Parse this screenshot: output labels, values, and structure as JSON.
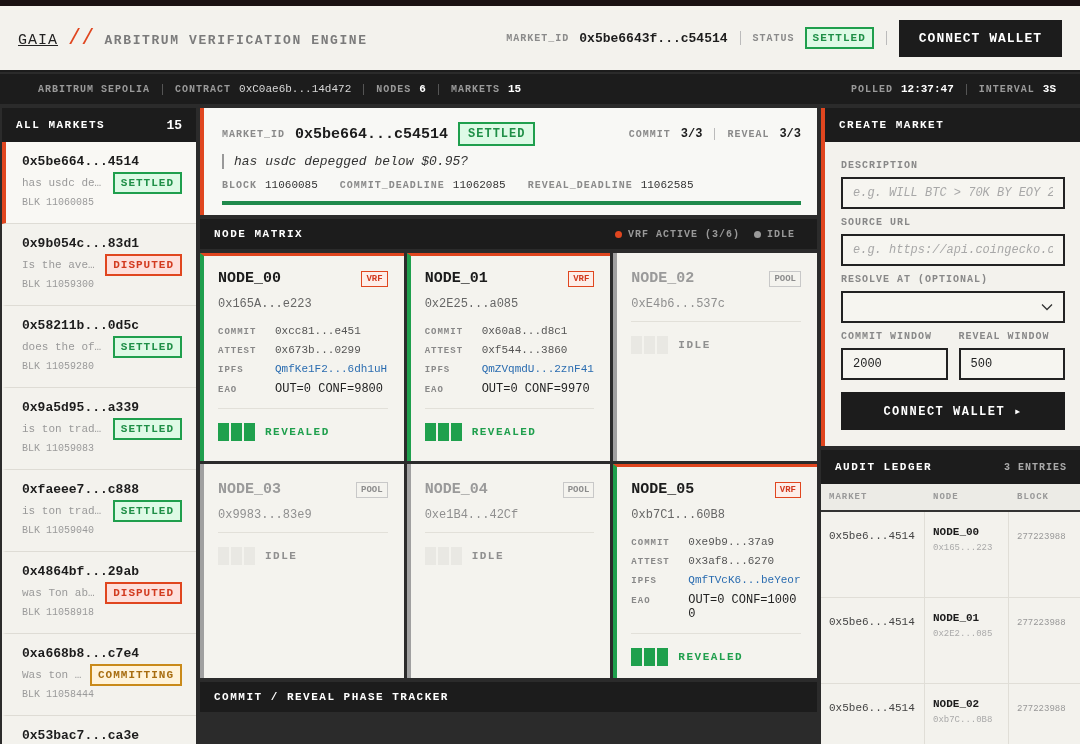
{
  "header": {
    "brand": "GAIA",
    "separator": "//",
    "subtitle": "ARBITRUM VERIFICATION ENGINE",
    "market_id_label": "MARKET_ID",
    "market_id": "0x5be6643f...c54514",
    "status_label": "STATUS",
    "status": {
      "label": "SETTLED",
      "kind": "settled"
    },
    "connect_button": "CONNECT WALLET"
  },
  "status_bar": {
    "left": [
      {
        "label": "ARBITRUM SEPOLIA"
      },
      {
        "label": "CONTRACT",
        "value": "0xC0ae6b...14d472",
        "strong": false
      },
      {
        "label": "NODES",
        "value": "6",
        "strong": true
      },
      {
        "label": "MARKETS",
        "value": "15",
        "strong": true
      }
    ],
    "right": [
      {
        "label": "POLLED",
        "value": "12:37:47",
        "strong": true
      },
      {
        "label": "INTERVAL",
        "value": "3S",
        "strong": true
      }
    ]
  },
  "markets": {
    "title": "ALL MARKETS",
    "count": "15",
    "items": [
      {
        "id": "0x5be664...4514",
        "desc": "has usdc de…",
        "status": {
          "label": "SETTLED",
          "kind": "settled"
        },
        "block": "BLK 11060085",
        "selected": true
      },
      {
        "id": "0x9b054c...83d1",
        "desc": "Is the ave…",
        "status": {
          "label": "DISPUTED",
          "kind": "disputed"
        },
        "block": "BLK 11059300",
        "selected": false
      },
      {
        "id": "0x58211b...0d5c",
        "desc": "does the of…",
        "status": {
          "label": "SETTLED",
          "kind": "settled"
        },
        "block": "BLK 11059280",
        "selected": false
      },
      {
        "id": "0x9a5d95...a339",
        "desc": "is ton trad…",
        "status": {
          "label": "SETTLED",
          "kind": "settled"
        },
        "block": "BLK 11059083",
        "selected": false
      },
      {
        "id": "0xfaeee7...c888",
        "desc": "is ton trad…",
        "status": {
          "label": "SETTLED",
          "kind": "settled"
        },
        "block": "BLK 11059040",
        "selected": false
      },
      {
        "id": "0x4864bf...29ab",
        "desc": "was Ton ab…",
        "status": {
          "label": "DISPUTED",
          "kind": "disputed"
        },
        "block": "BLK 11058918",
        "selected": false
      },
      {
        "id": "0xa668b8...c7e4",
        "desc": "Was ton …",
        "status": {
          "label": "COMMITTING",
          "kind": "committing"
        },
        "block": "BLK 11058444",
        "selected": false
      },
      {
        "id": "0x53bac7...ca3e",
        "selected": false
      }
    ]
  },
  "market_detail": {
    "id_label": "MARKET_ID",
    "id": "0x5be664...c54514",
    "status": {
      "label": "SETTLED",
      "kind": "settled"
    },
    "commit_label": "COMMIT",
    "commit": "3/3",
    "reveal_label": "REVEAL",
    "reveal": "3/3",
    "question": "has usdc depegged below $0.95?",
    "facts": [
      {
        "label": "BLOCK",
        "value": "11060085"
      },
      {
        "label": "COMMIT_DEADLINE",
        "value": "11062085"
      },
      {
        "label": "REVEAL_DEADLINE",
        "value": "11062585"
      }
    ],
    "progress": {
      "level": 1
    }
  },
  "node_matrix": {
    "title": "NODE MATRIX",
    "legend": [
      {
        "label": "VRF ACTIVE (3/6)",
        "color": "#e0461f"
      },
      {
        "label": "IDLE",
        "color": "#9a9a9a"
      }
    ],
    "nodes": [
      {
        "name": "NODE_00",
        "kind": "vrf",
        "badge": "VRF",
        "address": "0x165A...e223",
        "fields": [
          {
            "label": "COMMIT",
            "value": "0xcc81...e451",
            "kind": "hash"
          },
          {
            "label": "ATTEST",
            "value": "0x673b...0299",
            "kind": "hash"
          },
          {
            "label": "IPFS",
            "value": "QmfKe1F2...6dh1uH",
            "kind": "link"
          },
          {
            "label": "EAO",
            "value": "OUT=0 CONF=9800",
            "kind": "plain"
          }
        ],
        "state": "REVEALED"
      },
      {
        "name": "NODE_01",
        "kind": "vrf",
        "badge": "VRF",
        "address": "0x2E25...a085",
        "fields": [
          {
            "label": "COMMIT",
            "value": "0x60a8...d8c1",
            "kind": "hash"
          },
          {
            "label": "ATTEST",
            "value": "0xf544...3860",
            "kind": "hash"
          },
          {
            "label": "IPFS",
            "value": "QmZVqmdU...2znF41",
            "kind": "link"
          },
          {
            "label": "EAO",
            "value": "OUT=0 CONF=9970",
            "kind": "plain"
          }
        ],
        "state": "REVEALED"
      },
      {
        "name": "NODE_02",
        "kind": "pool",
        "badge": "POOL",
        "address": "0xE4b6...537c",
        "state": "IDLE"
      },
      {
        "name": "NODE_03",
        "kind": "pool",
        "badge": "POOL",
        "address": "0x9983...83e9",
        "state": "IDLE"
      },
      {
        "name": "NODE_04",
        "kind": "pool",
        "badge": "POOL",
        "address": "0xe1B4...42Cf",
        "state": "IDLE"
      },
      {
        "name": "NODE_05",
        "kind": "vrf",
        "badge": "VRF",
        "address": "0xb7C1...60B8",
        "fields": [
          {
            "label": "COMMIT",
            "value": "0xe9b9...37a9",
            "kind": "hash"
          },
          {
            "label": "ATTEST",
            "value": "0x3af8...6270",
            "kind": "hash"
          },
          {
            "label": "IPFS",
            "value": "QmfTVcK6...beYeor",
            "kind": "link"
          },
          {
            "label": "EAO",
            "value": "OUT=0 CONF=10000",
            "kind": "plain"
          }
        ],
        "state": "REVEALED"
      }
    ]
  },
  "phase_tracker": {
    "title": "COMMIT / REVEAL PHASE TRACKER"
  },
  "create_market": {
    "title": "CREATE MARKET",
    "description": {
      "label": "DESCRIPTION",
      "placeholder": "e.g. WILL BTC > 70K BY EOY 2"
    },
    "source_url": {
      "label": "SOURCE URL",
      "placeholder": "e.g. https://api.coingecko.c"
    },
    "resolve_at": {
      "label": "RESOLVE AT (OPTIONAL)"
    },
    "commit_window": {
      "label": "COMMIT WINDOW",
      "value": "2000"
    },
    "reveal_window": {
      "label": "REVEAL WINDOW",
      "value": "500"
    },
    "button": "CONNECT WALLET ▸"
  },
  "audit_ledger": {
    "title": "AUDIT LEDGER",
    "count": "3 ENTRIES",
    "columns": [
      "MARKET",
      "NODE",
      "BLOCK"
    ],
    "rows": [
      {
        "market": "0x5be6...4514",
        "node": "NODE_00",
        "node_address": "0x165...223",
        "block": "277223988"
      },
      {
        "market": "0x5be6...4514",
        "node": "NODE_01",
        "node_address": "0x2E2...085",
        "block": "277223988"
      },
      {
        "market": "0x5be6...4514",
        "node": "NODE_02",
        "node_address": "0xb7C...0B8",
        "block": "277223988"
      }
    ]
  }
}
